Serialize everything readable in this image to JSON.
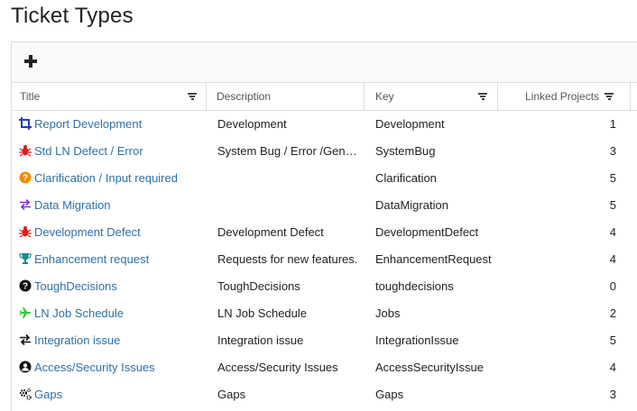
{
  "page": {
    "title": "Ticket Types"
  },
  "toolbar": {
    "add_icon": "plus-icon"
  },
  "columns": [
    {
      "label": "Title",
      "filter": true
    },
    {
      "label": "Description",
      "filter": false
    },
    {
      "label": "Key",
      "filter": true
    },
    {
      "label": "Linked Projects",
      "filter": true
    }
  ],
  "rows": [
    {
      "icon": "crop-icon",
      "icon_color": "#1f3fbf",
      "title": "Report Development",
      "description": "Development",
      "key": "Development",
      "linked": "1"
    },
    {
      "icon": "bug-icon",
      "icon_color": "#d62020",
      "title": "Std LN Defect / Error",
      "description": "System Bug / Error /General Issue",
      "key": "SystemBug",
      "linked": "3"
    },
    {
      "icon": "question-circle-icon",
      "icon_color": "#f08c00",
      "title": "Clarification / Input required",
      "description": "",
      "key": "Clarification",
      "linked": "5"
    },
    {
      "icon": "exchange-icon",
      "icon_color": "#8a2be2",
      "title": "Data Migration",
      "description": "",
      "key": "DataMigration",
      "linked": "5"
    },
    {
      "icon": "bug-icon",
      "icon_color": "#d62020",
      "title": "Development Defect",
      "description": "Development Defect",
      "key": "DevelopmentDefect",
      "linked": "4"
    },
    {
      "icon": "trophy-icon",
      "icon_color": "#1a8a8a",
      "title": "Enhancement request",
      "description": "Requests for new features.",
      "key": "EnhancementRequest",
      "linked": "4"
    },
    {
      "icon": "question-circle-icon",
      "icon_color": "#111111",
      "title": "ToughDecisions",
      "description": "ToughDecisions",
      "key": "toughdecisions",
      "linked": "0"
    },
    {
      "icon": "plane-icon",
      "icon_color": "#2ecc2e",
      "title": "LN Job Schedule",
      "description": "LN Job Schedule",
      "key": "Jobs",
      "linked": "2"
    },
    {
      "icon": "exchange-icon",
      "icon_color": "#111111",
      "title": "Integration issue",
      "description": "Integration issue",
      "key": "IntegrationIssue",
      "linked": "5"
    },
    {
      "icon": "user-circle-icon",
      "icon_color": "#111111",
      "title": "Access/Security Issues",
      "description": "Access/Security Issues",
      "key": "AccessSecurityIssue",
      "linked": "4"
    },
    {
      "icon": "cogs-icon",
      "icon_color": "#111111",
      "title": "Gaps",
      "description": "Gaps",
      "key": "Gaps",
      "linked": "3"
    }
  ]
}
